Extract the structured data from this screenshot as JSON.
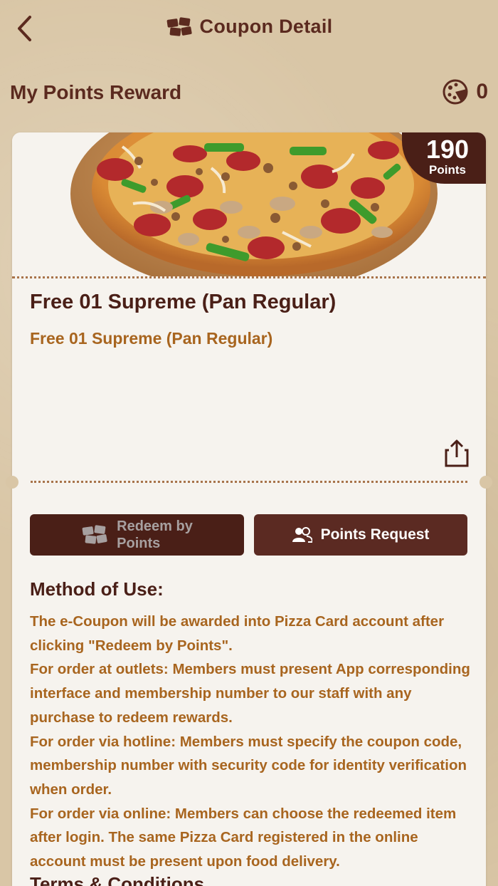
{
  "header": {
    "title": "Coupon Detail"
  },
  "section": {
    "title": "My Points Reward",
    "points": "0"
  },
  "coupon": {
    "points_value": "190",
    "points_label": "Points",
    "title": "Free 01  Supreme (Pan Regular)",
    "subtitle": "Free 01 Supreme (Pan Regular)"
  },
  "buttons": {
    "redeem_line1": "Redeem by",
    "redeem_line2": "Points",
    "request": "Points Request"
  },
  "method": {
    "heading": "Method of Use:",
    "paragraphs": [
      "The e-Coupon will be awarded into Pizza Card account after clicking \"Redeem by Points\".",
      "For order at outlets: Members must present App corresponding interface and membership number to our staff with any purchase to redeem rewards.",
      "For order via hotline: Members must specify the coupon code, membership number with security code for identity verification when order.",
      "For order via online: Members can choose the redeemed item after login. The same Pizza Card registered in the online account must be present upon food delivery."
    ]
  },
  "terms": {
    "heading": "Terms & Conditions"
  },
  "colors": {
    "brand_dark": "#4a1f17",
    "accent_text": "#a8651f",
    "background": "#d9c6a6"
  },
  "icons": [
    "back-chevron-icon",
    "coupon-icon",
    "pizza-points-icon",
    "share-icon",
    "users-icon"
  ]
}
